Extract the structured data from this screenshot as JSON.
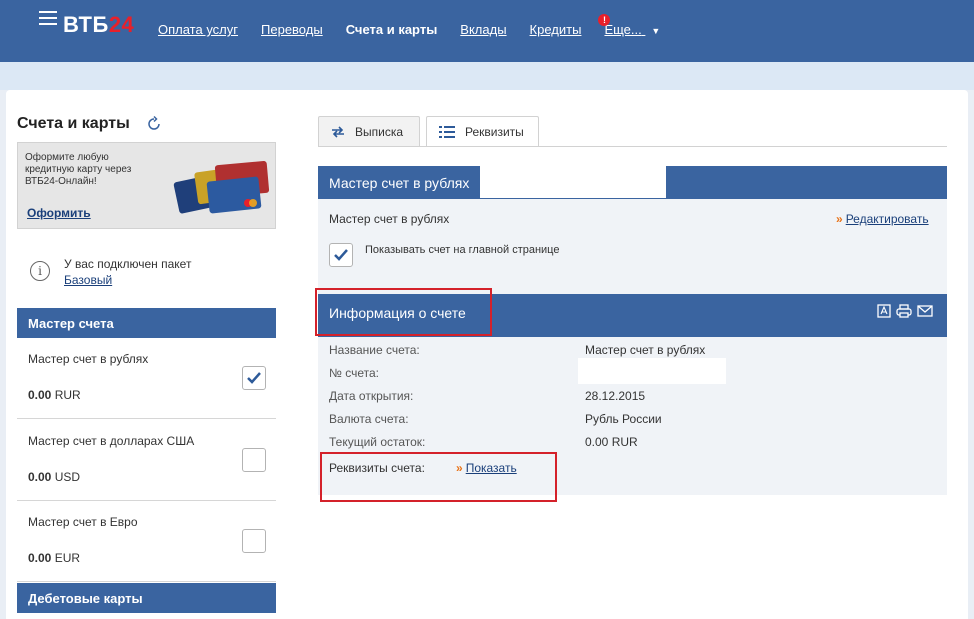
{
  "header": {
    "logo_text": "ВТБ",
    "logo_num": "24",
    "nav": [
      {
        "label": "Оплата услуг",
        "active": false
      },
      {
        "label": "Переводы",
        "active": false
      },
      {
        "label": "Счета и карты",
        "active": true
      },
      {
        "label": "Вклады",
        "active": false
      },
      {
        "label": "Кредиты",
        "active": false
      }
    ],
    "more_label": "Еще...",
    "alert_badge": "!"
  },
  "sidebar": {
    "title": "Счета и карты",
    "promo": {
      "text": "Оформите любую кредитную карту через ВТБ24-Онлайн!",
      "link": "Оформить"
    },
    "package": {
      "text": "У вас подключен пакет",
      "link": "Базовый"
    },
    "master_header": "Мастер счета",
    "accounts": [
      {
        "name": "Мастер счет в рублях",
        "amount": "0.00",
        "currency": "RUR",
        "checked": true
      },
      {
        "name": "Мастер счет в долларах США",
        "amount": "0.00",
        "currency": "USD",
        "checked": false
      },
      {
        "name": "Мастер счет в Евро",
        "amount": "0.00",
        "currency": "EUR",
        "checked": false
      }
    ],
    "debit_header": "Дебетовые карты"
  },
  "tabs": [
    {
      "label": "Выписка",
      "icon": "arrows-icon",
      "active": false
    },
    {
      "label": "Реквизиты",
      "icon": "list-icon",
      "active": true
    }
  ],
  "account_section": {
    "header": "Мастер счет в рублях",
    "name": "Мастер счет в рублях",
    "edit_link": "Редактировать",
    "show_on_main_label": "Показывать счет на главной странице",
    "show_on_main_checked": true
  },
  "info_section": {
    "header": "Информация о счете",
    "icons": [
      "pdf-icon",
      "print-icon",
      "mail-icon"
    ],
    "rows": [
      {
        "label": "Название счета:",
        "value": "Мастер счет в рублях"
      },
      {
        "label": "№ счета:",
        "value": ""
      },
      {
        "label": "Дата открытия:",
        "value": "28.12.2015"
      },
      {
        "label": "Валюта счета:",
        "value": "Рубль России"
      },
      {
        "label": "Текущий остаток:",
        "value": "0.00 RUR"
      }
    ],
    "requisites_label": "Реквизиты счета:",
    "requisites_link": "Показать"
  },
  "colors": {
    "brand_blue": "#3a64a0",
    "brand_red": "#e8202a",
    "link_orange": "#e8741b",
    "highlight_red": "#d4212a"
  }
}
